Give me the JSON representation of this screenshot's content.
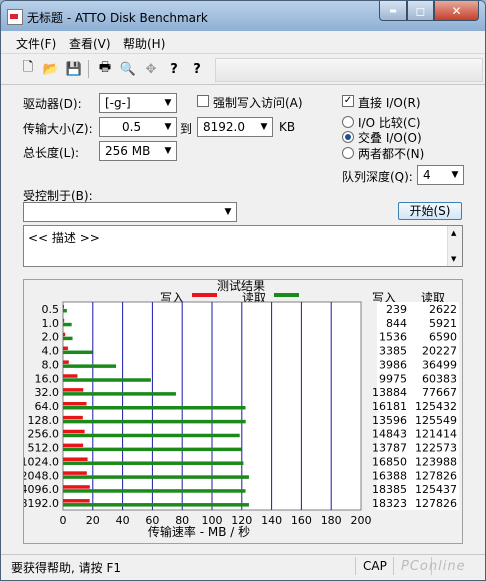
{
  "window": {
    "title": "无标题 - ATTO Disk Benchmark",
    "min_glyph": "▬",
    "max_glyph": "◻",
    "close_glyph": "✕"
  },
  "menu": [
    "文件(F)",
    "查看(V)",
    "帮助(H)"
  ],
  "toolbar": {
    "icons": [
      "new-file-icon",
      "open-folder-icon",
      "save-icon",
      "print-icon",
      "print-preview-icon",
      "move-icon",
      "help-icon",
      "context-help-icon"
    ],
    "glyphs": [
      "🗋",
      "📂",
      "💾",
      "🖶",
      "🔍",
      "✥",
      "?",
      "?"
    ]
  },
  "settings": {
    "drive_label": "驱动器(D):",
    "drive_value": "[-g-]",
    "force_write_label": "强制写入访问(A)",
    "direct_io_label": "直接 I/O(R)",
    "direct_io_checked_glyph": "✓",
    "transfer_size_label": "传输大小(Z):",
    "transfer_from": "0.5",
    "transfer_to_label": "到",
    "transfer_to": "8192.0",
    "transfer_unit": "KB",
    "total_length_label": "总长度(L):",
    "total_length_value": "256 MB",
    "io_compare_label": "I/O 比较(C)",
    "overlapped_io_label": "交叠 I/O(O)",
    "neither_label": "两者都不(N)",
    "queue_depth_label": "队列深度(Q):",
    "queue_depth_value": "4",
    "controlled_by_label": "受控制于(B):",
    "controlled_by_value": "",
    "start_button": "开始(S)",
    "description": "<< 描述 >>",
    "dropdown_arrow": "▼"
  },
  "results": {
    "title": "测试结果",
    "legend_write": "写入",
    "legend_read": "读取",
    "col_write": "写入",
    "col_read": "读取",
    "colors": {
      "write": "#e8141a",
      "read": "#1b8a1b",
      "grid": "#1a1aaa"
    }
  },
  "chart_data": {
    "type": "bar",
    "orientation": "horizontal",
    "title": "测试结果",
    "xlabel": "传输速率 - MB / 秒",
    "xlim": [
      0,
      200
    ],
    "xticks": [
      0,
      20,
      40,
      60,
      80,
      100,
      120,
      140,
      160,
      180,
      200
    ],
    "grid": true,
    "categories": [
      "0.5",
      "1.0",
      "2.0",
      "4.0",
      "8.0",
      "16.0",
      "32.0",
      "64.0",
      "128.0",
      "256.0",
      "512.0",
      "1024.0",
      "2048.0",
      "4096.0",
      "8192.0"
    ],
    "series": [
      {
        "name": "写入",
        "values": [
          0.2,
          0.8,
          1.5,
          3.3,
          3.9,
          9.7,
          13.6,
          15.8,
          13.3,
          14.5,
          13.5,
          16.5,
          16.0,
          18.0,
          17.9
        ]
      },
      {
        "name": "读取",
        "values": [
          2.6,
          5.8,
          6.4,
          19.8,
          35.6,
          59.0,
          75.8,
          122.5,
          122.6,
          118.6,
          119.7,
          121.1,
          124.8,
          122.5,
          124.8
        ]
      }
    ],
    "table_write": [
      "239",
      "844",
      "1536",
      "3385",
      "3986",
      "9975",
      "13884",
      "16181",
      "13596",
      "14843",
      "13787",
      "16850",
      "16388",
      "18385",
      "18323"
    ],
    "table_read": [
      "2622",
      "5921",
      "6590",
      "20227",
      "36499",
      "60383",
      "77667",
      "125432",
      "125549",
      "121414",
      "122573",
      "123988",
      "127826",
      "125437",
      "127826"
    ]
  },
  "status": {
    "help_text": "要获得帮助, 请按 F1",
    "cap": "CAP",
    "watermark": "PConline"
  }
}
